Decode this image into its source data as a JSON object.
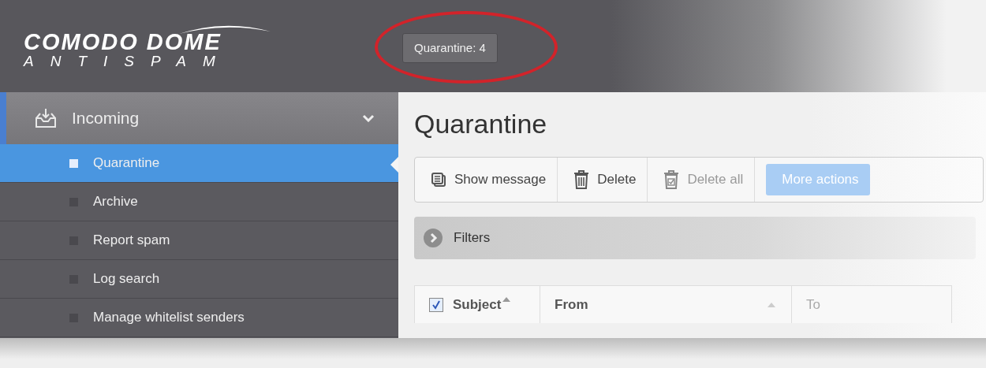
{
  "header": {
    "logo": {
      "name": "COMODO DOME",
      "subtitle": "ANTISPAM"
    },
    "quarantine_button": {
      "label": "Quarantine: 4",
      "highlighted": true
    }
  },
  "sidebar": {
    "section": {
      "label": "Incoming",
      "expanded": true
    },
    "items": [
      {
        "label": "Quarantine",
        "selected": true
      },
      {
        "label": "Archive",
        "selected": false
      },
      {
        "label": "Report spam",
        "selected": false
      },
      {
        "label": "Log search",
        "selected": false
      },
      {
        "label": "Manage whitelist senders",
        "selected": false
      }
    ]
  },
  "page_title": "Quarantine",
  "toolbar": [
    {
      "label": "Show message",
      "kind": "message",
      "disabled": false
    },
    {
      "label": "Delete",
      "kind": "trash",
      "disabled": false
    },
    {
      "label": "Delete all",
      "kind": "trash-all",
      "disabled": true
    },
    {
      "label": "More actions",
      "kind": "primary",
      "disabled": false
    }
  ],
  "filters": {
    "label": "Filters",
    "expanded": false
  },
  "table": {
    "select_all": {
      "checked": true
    },
    "columns": [
      {
        "label": "Subject",
        "sort_arrow": true,
        "muted": false
      },
      {
        "label": "From",
        "sort_arrow": true,
        "muted": false
      },
      {
        "label": "To",
        "sort_arrow": false,
        "muted": true
      }
    ]
  }
}
